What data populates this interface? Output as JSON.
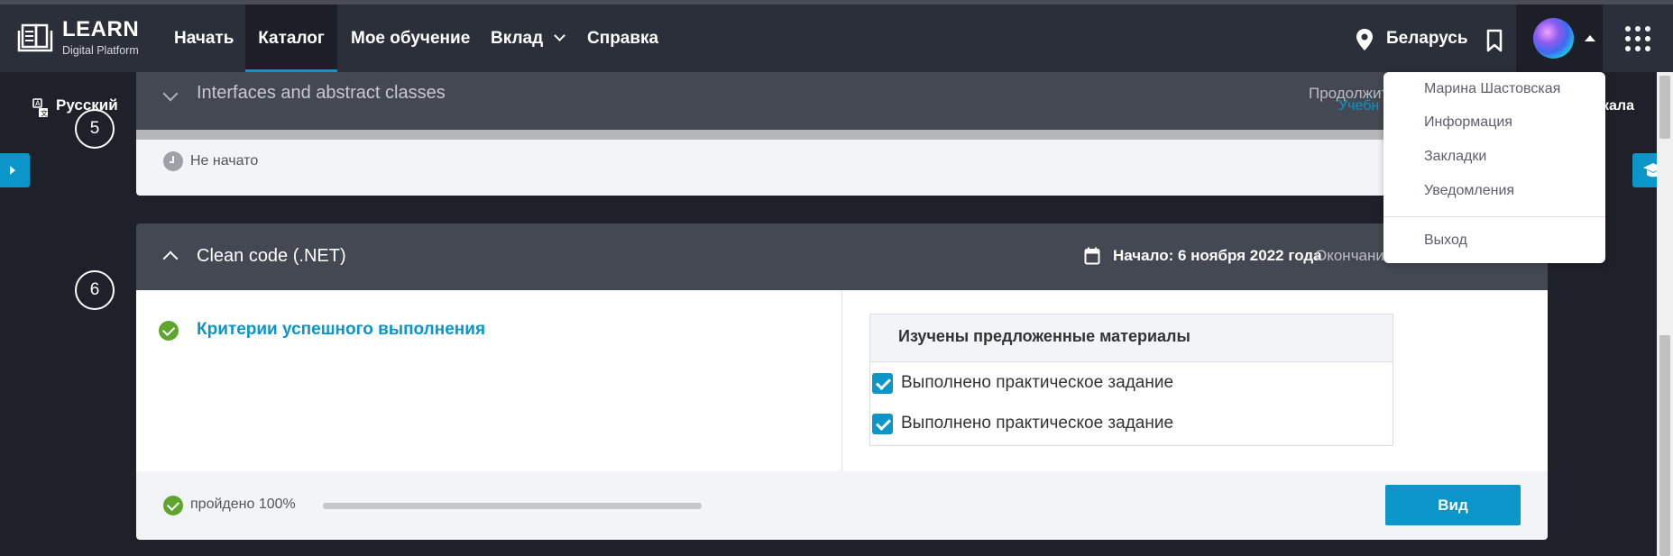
{
  "navbar": {
    "logo_title": "LEARN",
    "logo_subtitle": "Digital Platform",
    "items": [
      {
        "label": "Начать"
      },
      {
        "label": "Каталог",
        "active": true
      },
      {
        "label": "Мое обучение"
      },
      {
        "label": "Вклад",
        "has_dropdown": true
      },
      {
        "label": "Справка"
      }
    ],
    "location_icon": "map-pin-icon",
    "country": "Беларусь",
    "bookmark_icon": "bookmark-icon",
    "apps_icon": "apps-grid-icon"
  },
  "subbar": {
    "language": "Русский",
    "continue_text": "Продолжит",
    "tab_text": "Учебн",
    "scale_text": "кала"
  },
  "module5": {
    "number": "5",
    "title": "Interfaces and abstract classes",
    "status": "Не начато"
  },
  "module6": {
    "number": "6",
    "title": "Clean code (.NET)",
    "start": "Начало: 6 ноября 2022 года",
    "end": "Окончани",
    "criteria_link": "Критерии успешного выполнения",
    "criteria_title": "Изучены предложенные материалы",
    "criteria_items": [
      {
        "label": "Выполнено практическое задание",
        "checked": true
      },
      {
        "label": "Выполнено практическое задание",
        "checked": true
      }
    ],
    "progress_label": "пройдено 100%",
    "progress_value": 100,
    "view_button": "Вид"
  },
  "user_menu": {
    "user_name": "Марина Шастовская",
    "items": [
      "Информация",
      "Закладки",
      "Уведомления"
    ],
    "logout": "Выход"
  },
  "colors": {
    "accent": "#0a96c8",
    "success": "#5ea52b",
    "navbar": "#2b2f3a",
    "module_header": "#444852"
  }
}
